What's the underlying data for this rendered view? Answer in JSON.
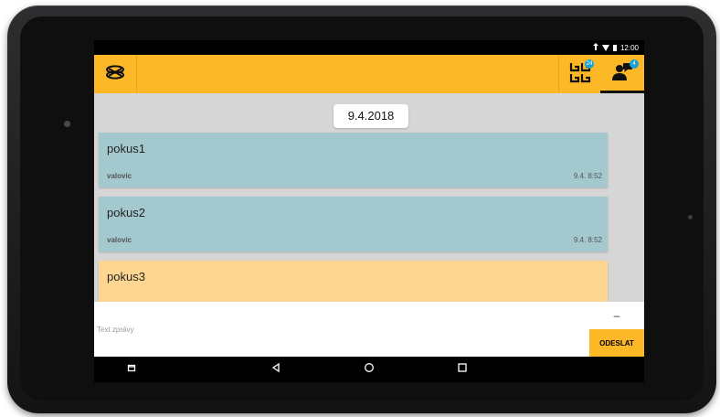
{
  "statusbar": {
    "time": "12:00",
    "icons": [
      "signal-icon",
      "wifi-icon",
      "battery-icon"
    ]
  },
  "appbar": {
    "logo_icon": "logo-icon",
    "tabs": [
      {
        "name": "groups",
        "icon": "groups-icon",
        "badge": "24"
      },
      {
        "name": "user",
        "icon": "user-chat-icon",
        "badge": "4",
        "active": true
      }
    ],
    "accent_color": "#fdb827"
  },
  "chat": {
    "date": "9.4.2018",
    "messages": [
      {
        "text": "pokus1",
        "author": "valovic",
        "time": "9.4. 8:52",
        "color": "#a3c9cf"
      },
      {
        "text": "pokus2",
        "author": "valovic",
        "time": "9.4. 8:52",
        "color": "#a3c9cf"
      },
      {
        "text": "pokus3",
        "author": "",
        "time": "",
        "color": "#fdd791"
      }
    ]
  },
  "composer": {
    "placeholder": "Text zprávy",
    "value": "",
    "minus_label": "–",
    "send_label": "ODESLAT"
  },
  "navbar": {
    "buttons": [
      "recents-small-icon",
      "back-icon",
      "home-icon",
      "overview-icon"
    ]
  }
}
